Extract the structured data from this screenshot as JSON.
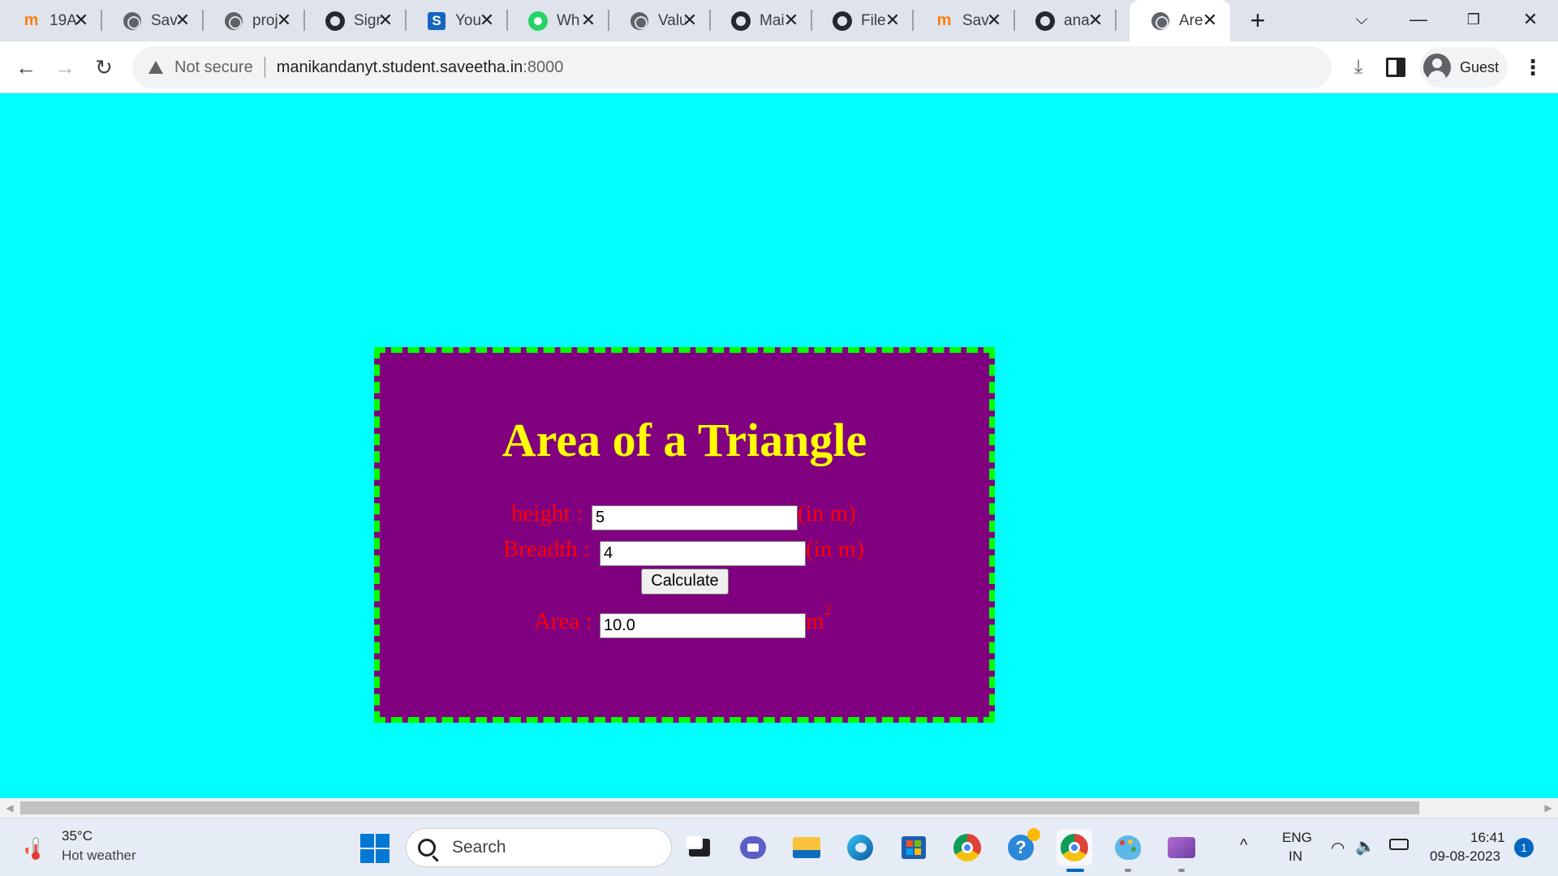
{
  "browser": {
    "tabs": [
      {
        "title": "19A",
        "favicon": "moodle-icon"
      },
      {
        "title": "Sav",
        "favicon": "globe-icon"
      },
      {
        "title": "proj",
        "favicon": "globe-icon"
      },
      {
        "title": "Sign",
        "favicon": "github-icon"
      },
      {
        "title": "You",
        "favicon": "s-icon"
      },
      {
        "title": "Wh",
        "favicon": "whatsapp-icon"
      },
      {
        "title": "Valu",
        "favicon": "globe-icon"
      },
      {
        "title": "Mai",
        "favicon": "github-icon"
      },
      {
        "title": "File",
        "favicon": "github-icon"
      },
      {
        "title": "Sav",
        "favicon": "moodle-icon"
      },
      {
        "title": "ana",
        "favicon": "github-icon"
      },
      {
        "title": "Are",
        "favicon": "globe-icon",
        "active": true
      }
    ],
    "security_label": "Not secure",
    "url_host": "manikandanyt.student.saveetha.in",
    "url_port": ":8000",
    "profile_label": "Guest"
  },
  "page": {
    "title": "Area of a Triangle",
    "height_label": "height :",
    "height_value": "5",
    "height_unit": "(in m)",
    "breadth_label": "Breadth :",
    "breadth_value": "4",
    "breadth_unit": "(in m)",
    "button_label": "Calculate",
    "area_label": "Area :",
    "area_value": "10.0",
    "area_unit": "m",
    "area_unit_exp": "2",
    "colors": {
      "background": "#00FFFF",
      "card": "#800080",
      "border": "#00FF00",
      "title": "#FFFF00",
      "labels": "#FF0000"
    }
  },
  "taskbar": {
    "weather_temp": "35°C",
    "weather_desc": "Hot weather",
    "search_placeholder": "Search",
    "lang_top": "ENG",
    "lang_bottom": "IN",
    "time": "16:41",
    "date": "09-08-2023",
    "notifications": "1"
  }
}
